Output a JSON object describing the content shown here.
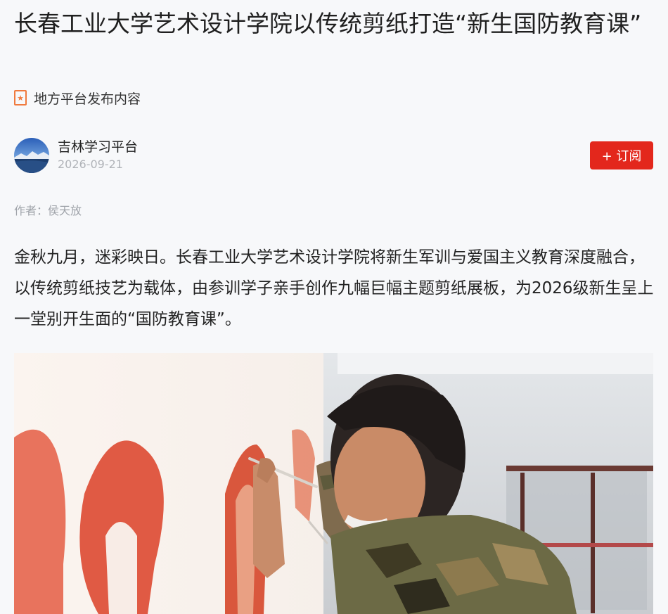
{
  "article": {
    "title": "长春工业大学艺术设计学院以传统剪纸打造“新生国防教育课”",
    "source_label": "地方平台发布内容",
    "author_name": "吉林学习平台",
    "publish_date": "2026-09-21",
    "subscribe_label": "+ 订阅",
    "byline": "作者：侯天放",
    "paragraph": "金秋九月，迷彩映日。长春工业大学艺术设计学院将新生军训与爱国主义教育深度融合，以传统剪纸技艺为载体，由参训学子亲手创作九幅巨幅主题剪纸展板，为2026级新生呈上一堂别开生面的“国防教育课”。"
  },
  "icons": {
    "source": "star-badge-icon"
  },
  "colors": {
    "accent": "#e3271c",
    "source_icon": "#f07a3e",
    "background": "#f7f8fa"
  }
}
